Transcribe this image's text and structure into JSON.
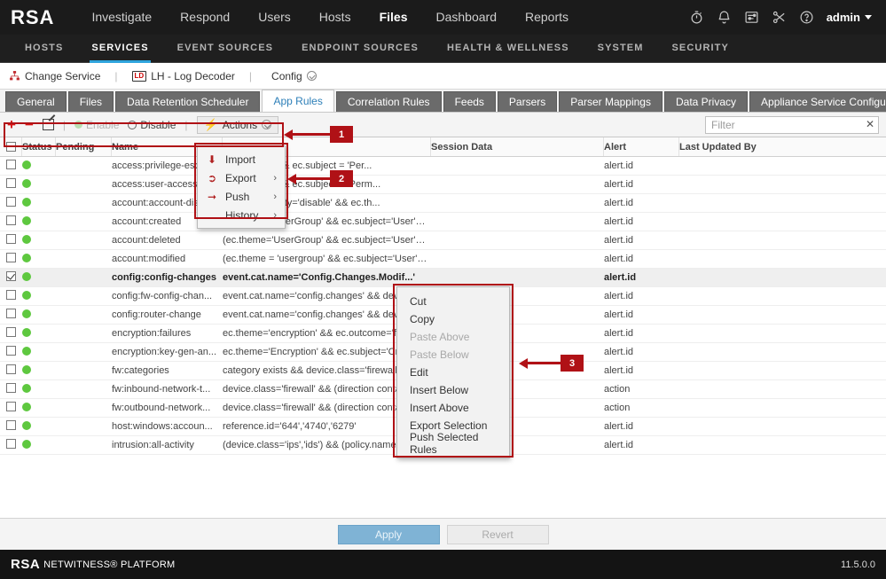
{
  "topnav": {
    "logo": "RSA",
    "items": [
      {
        "label": "Investigate",
        "active": false
      },
      {
        "label": "Respond",
        "active": false
      },
      {
        "label": "Users",
        "active": false
      },
      {
        "label": "Hosts",
        "active": false
      },
      {
        "label": "Files",
        "active": true
      },
      {
        "label": "Dashboard",
        "active": false
      },
      {
        "label": "Reports",
        "active": false
      }
    ],
    "icons": [
      "timer-icon",
      "bell-icon",
      "tasks-icon",
      "tools-icon",
      "help-icon"
    ],
    "user": "admin"
  },
  "subnav": {
    "items": [
      {
        "label": "HOSTS",
        "active": false
      },
      {
        "label": "SERVICES",
        "active": true
      },
      {
        "label": "EVENT SOURCES",
        "active": false
      },
      {
        "label": "ENDPOINT SOURCES",
        "active": false
      },
      {
        "label": "HEALTH & WELLNESS",
        "active": false
      },
      {
        "label": "SYSTEM",
        "active": false
      },
      {
        "label": "SECURITY",
        "active": false
      }
    ]
  },
  "breadcrumb": {
    "change_service": "Change Service",
    "service_badge": "LD",
    "service_name": "LH - Log Decoder",
    "config": "Config"
  },
  "tabs": [
    {
      "label": "General",
      "active": false
    },
    {
      "label": "Files",
      "active": false
    },
    {
      "label": "Data Retention Scheduler",
      "active": false
    },
    {
      "label": "App Rules",
      "active": true
    },
    {
      "label": "Correlation Rules",
      "active": false
    },
    {
      "label": "Feeds",
      "active": false
    },
    {
      "label": "Parsers",
      "active": false
    },
    {
      "label": "Parser Mappings",
      "active": false
    },
    {
      "label": "Data Privacy",
      "active": false
    },
    {
      "label": "Appliance Service Configuration",
      "active": false
    }
  ],
  "toolbar": {
    "add_label": "+",
    "remove_label": "−",
    "edit_icon": "edit-icon",
    "enable_label": "Enable",
    "disable_label": "Disable",
    "actions_label": "Actions",
    "filter_placeholder": "Filter",
    "filter_value": "",
    "clear_label": "✕"
  },
  "actions_menu": {
    "items": [
      {
        "label": "Import",
        "icon": "import-icon",
        "submenu": false
      },
      {
        "label": "Export",
        "icon": "export-icon",
        "submenu": true
      },
      {
        "label": "Push",
        "icon": "push-icon",
        "submenu": true
      },
      {
        "label": "History",
        "icon": "",
        "submenu": true
      }
    ]
  },
  "context_menu": {
    "items": [
      {
        "label": "Cut",
        "disabled": false
      },
      {
        "label": "Copy",
        "disabled": false
      },
      {
        "label": "Paste Above",
        "disabled": true
      },
      {
        "label": "Paste Below",
        "disabled": true
      },
      {
        "label": "Edit",
        "disabled": false
      },
      {
        "label": "Insert Below",
        "disabled": false
      },
      {
        "label": "Insert Above",
        "disabled": false
      },
      {
        "label": "Export Selection",
        "disabled": false
      },
      {
        "label": "Push Selected Rules",
        "disabled": false
      }
    ]
  },
  "grid": {
    "columns": [
      "",
      "Status",
      "Pending",
      "Name",
      "",
      "Session Data",
      "Alert",
      "Last Updated By"
    ],
    "rows": [
      {
        "checked": false,
        "name": "access:privilege-esca...",
        "rule": "...ssControl' && ec.subject = 'Per...",
        "session": "",
        "alert": "alert.id",
        "updated_by": ""
      },
      {
        "checked": false,
        "name": "access:user-access-r...",
        "rule": "...ssControl' && ec.subject = 'Perm...",
        "session": "",
        "alert": "alert.id",
        "updated_by": ""
      },
      {
        "checked": false,
        "name": "account:account-dis...",
        "rule": "... && ec.activity='disable' && ec.th...",
        "session": "",
        "alert": "alert.id",
        "updated_by": ""
      },
      {
        "checked": false,
        "name": "account:created",
        "rule": "(ec.theme='UserGroup' && ec.subject='User' && ...",
        "session": "",
        "alert": "alert.id",
        "updated_by": ""
      },
      {
        "checked": false,
        "name": "account:deleted",
        "rule": "(ec.theme='UserGroup' && ec.subject='User' && ...",
        "session": "",
        "alert": "alert.id",
        "updated_by": ""
      },
      {
        "checked": false,
        "name": "account:modified",
        "rule": "(ec.theme = 'usergroup' && ec.subject='User' && ...",
        "session": "",
        "alert": "alert.id",
        "updated_by": ""
      },
      {
        "checked": true,
        "name": "config:config-changes",
        "rule": "event.cat.name='Config.Changes.Modif...'",
        "session": "",
        "alert": "alert.id",
        "updated_by": ""
      },
      {
        "checked": false,
        "name": "config:fw-config-chan...",
        "rule": "event.cat.name='config.changes' && devi...",
        "session": "",
        "alert": "alert.id",
        "updated_by": ""
      },
      {
        "checked": false,
        "name": "config:router-change",
        "rule": "event.cat.name='config.changes' && devi...",
        "session": "",
        "alert": "alert.id",
        "updated_by": ""
      },
      {
        "checked": false,
        "name": "encryption:failures",
        "rule": "ec.theme='encryption' && ec.outcome='fa...",
        "session": "",
        "alert": "alert.id",
        "updated_by": ""
      },
      {
        "checked": false,
        "name": "encryption:key-gen-an...",
        "rule": "ec.theme='Encryption' && ec.subject='Cry...",
        "session": "",
        "alert": "alert.id",
        "updated_by": ""
      },
      {
        "checked": false,
        "name": "fw:categories",
        "rule": "category exists && device.class='firewall'",
        "session": "",
        "alert": "alert.id",
        "updated_by": ""
      },
      {
        "checked": false,
        "name": "fw:inbound-network-t...",
        "rule": "device.class='firewall' && (direction conta...",
        "session": "",
        "alert": "action",
        "updated_by": ""
      },
      {
        "checked": false,
        "name": "fw:outbound-network...",
        "rule": "device.class='firewall' && (direction conta...",
        "session": "",
        "alert": "action",
        "updated_by": ""
      },
      {
        "checked": false,
        "name": "host:windows:accoun...",
        "rule": "reference.id='644','4740','6279'",
        "session": "",
        "alert": "alert.id",
        "updated_by": ""
      },
      {
        "checked": false,
        "name": "intrusion:all-activity",
        "rule": "(device.class='ips','ids') && (policy.name exists ||...",
        "session": "",
        "alert": "alert.id",
        "updated_by": ""
      }
    ]
  },
  "actions_bar": {
    "apply_label": "Apply",
    "revert_label": "Revert"
  },
  "footer": {
    "brand": "RSA",
    "product": "NETWITNESS® PLATFORM",
    "version": "11.5.0.0"
  },
  "annotations": [
    {
      "label": "1"
    },
    {
      "label": "2"
    },
    {
      "label": "3"
    }
  ],
  "colors": {
    "accent_red": "#b01116",
    "apply_blue": "#7fb3d5",
    "status_green": "#5ec83f",
    "tab_active_text": "#2d7fb8",
    "subnav_underline": "#2fa5dd"
  }
}
